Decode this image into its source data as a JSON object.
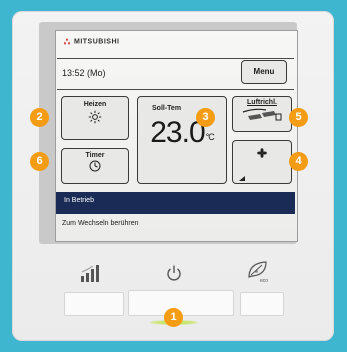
{
  "brand": "MITSUBISHI",
  "screen": {
    "clock": "13:52 (Mo)",
    "menu_label": "Menu",
    "mode_label": "Heizen",
    "timer_label": "Timer",
    "setpoint_label": "Soll-Tem",
    "setpoint_value": "23.0",
    "setpoint_unit": "°C",
    "airflow_label": "Luftrichl.",
    "status_text": "In Betrieb",
    "hint_text": "Zum Wechseln berühren"
  },
  "physical_buttons": [
    {
      "icon": "signal-bars-icon"
    },
    {
      "icon": "power-icon"
    },
    {
      "icon": "eco-leaf-icon"
    }
  ],
  "callouts": [
    "1",
    "2",
    "3",
    "4",
    "5",
    "6"
  ],
  "colors": {
    "background": "#3fb6cf",
    "badge": "#f39c14",
    "status_bar": "#1a2b55",
    "power_led": "#b8e04a"
  }
}
